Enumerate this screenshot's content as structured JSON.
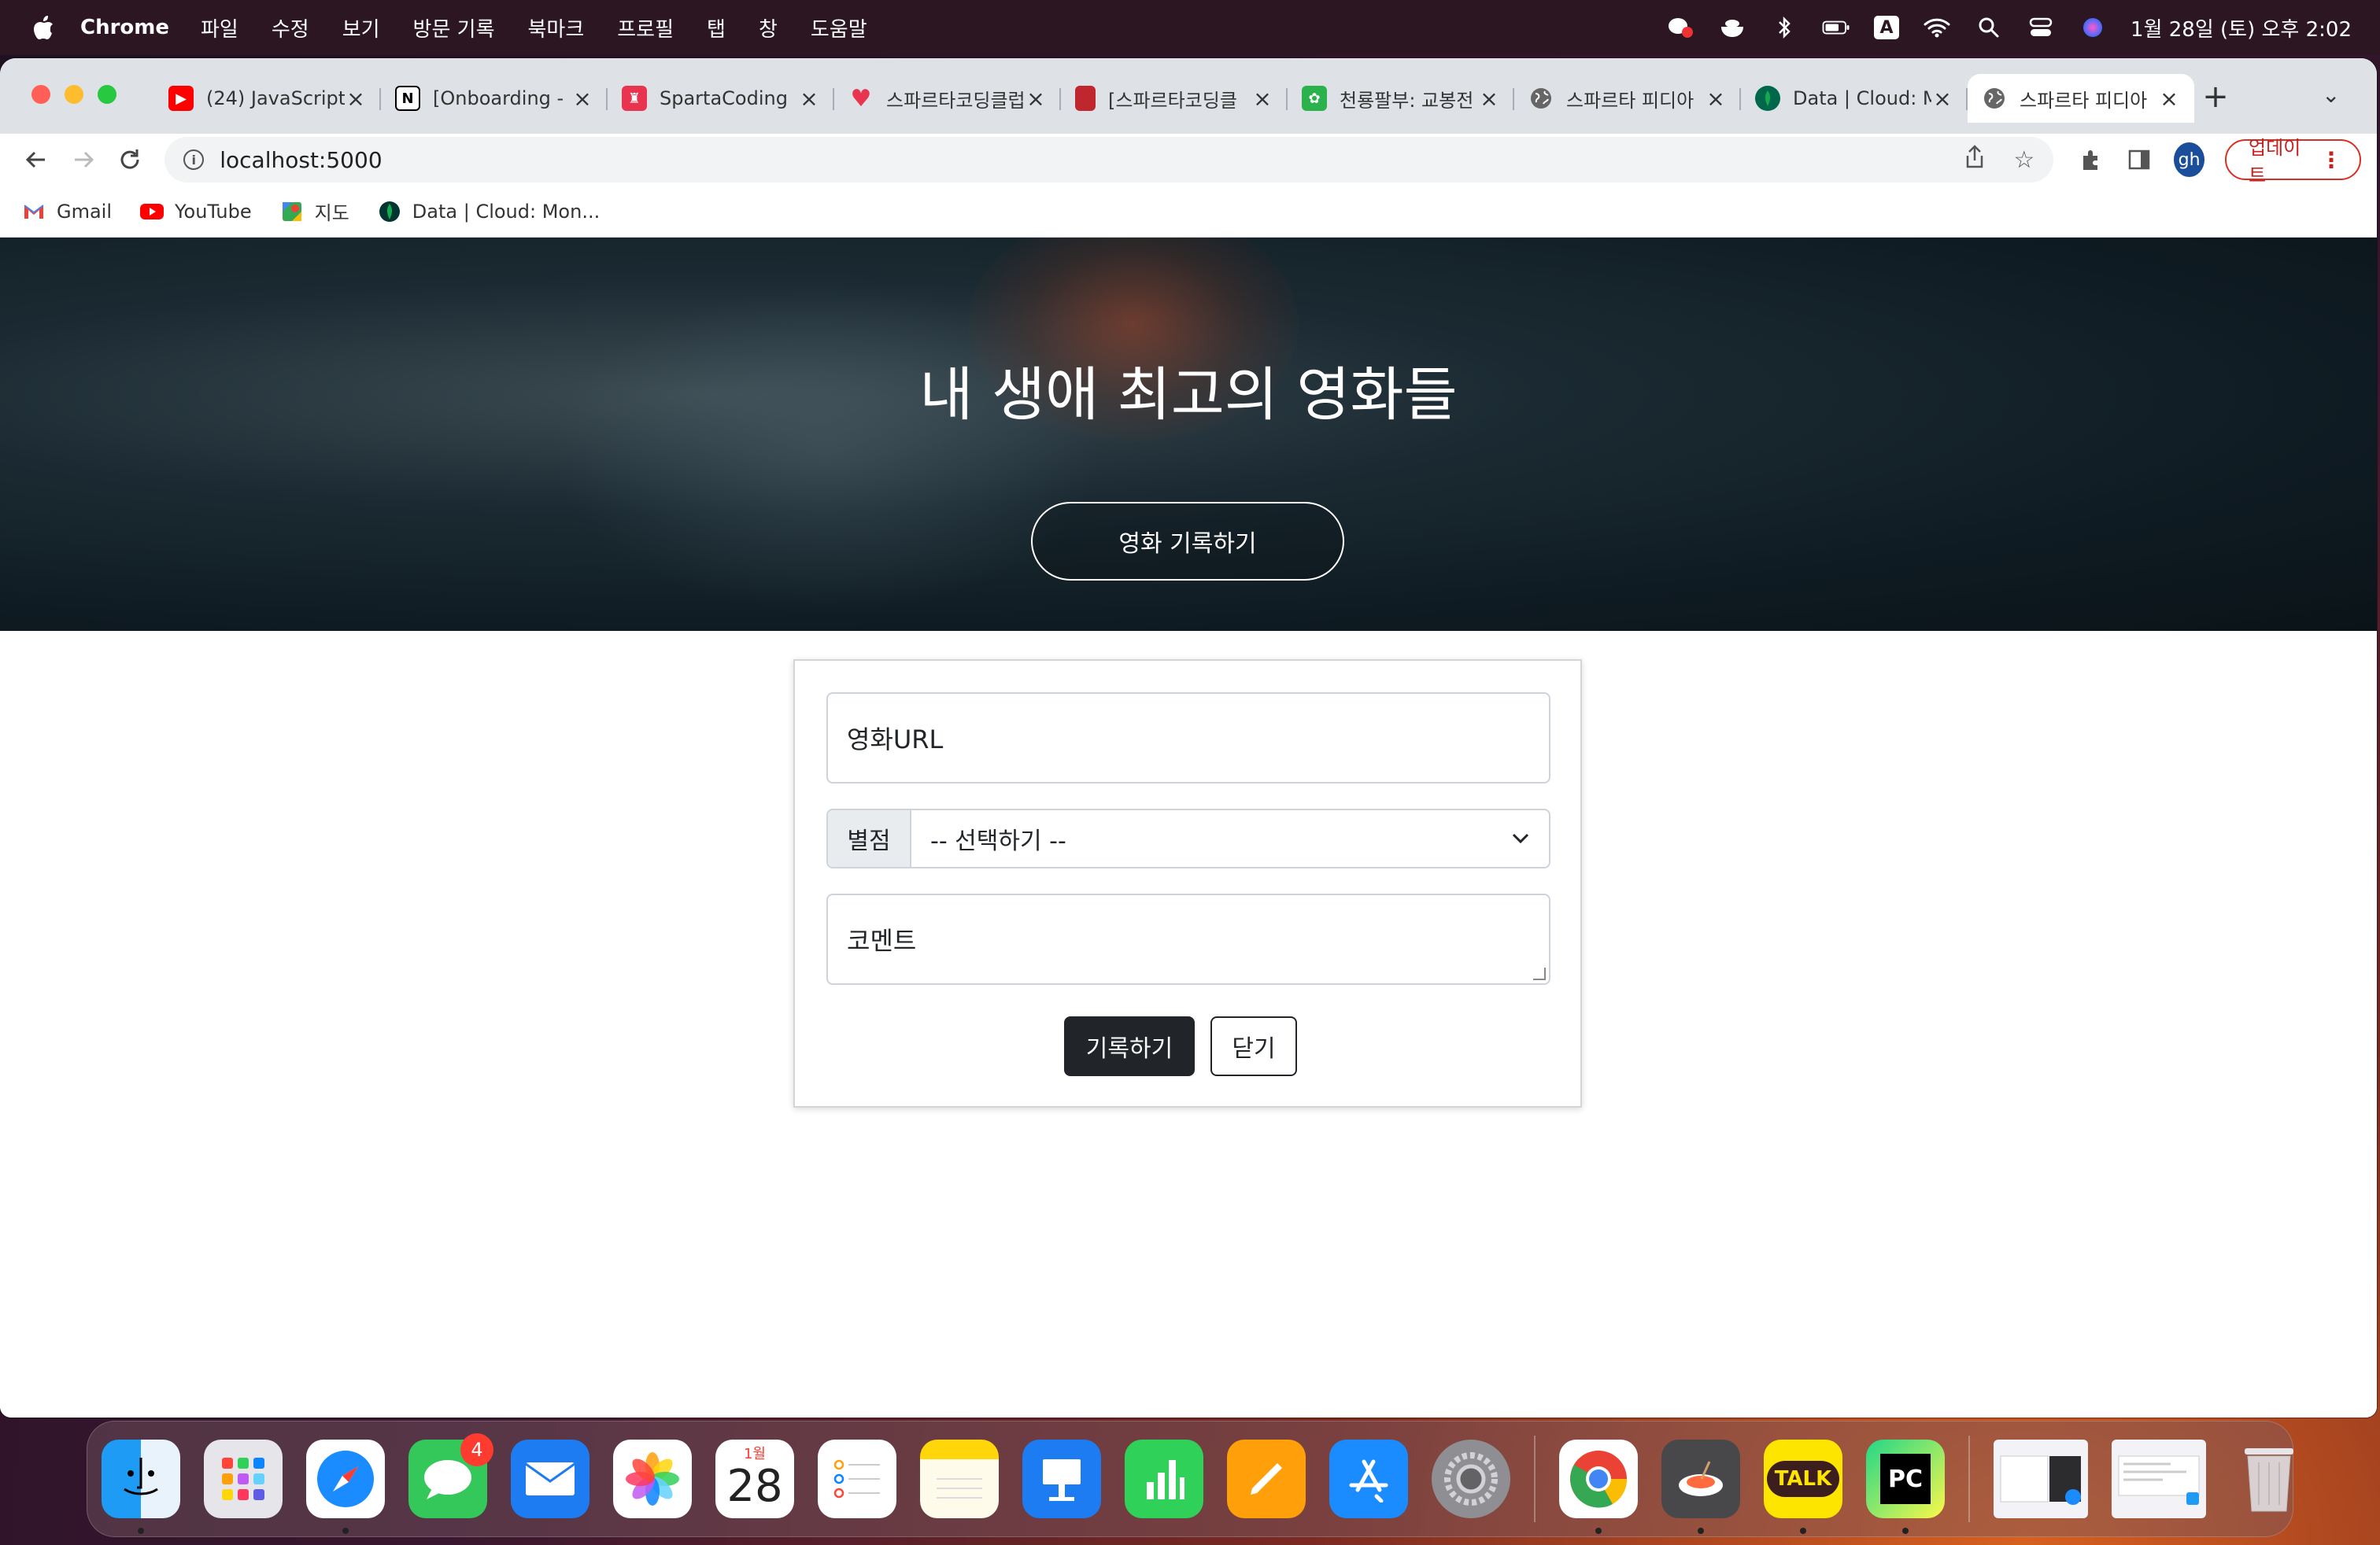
{
  "menubar": {
    "app_name": "Chrome",
    "menus": [
      "파일",
      "수정",
      "보기",
      "방문 기록",
      "북마크",
      "프로필",
      "탭",
      "창",
      "도움말"
    ],
    "clock": "1월 28일 (토) 오후 2:02",
    "input_indicator": "A"
  },
  "tabs": [
    {
      "title": "(24) JavaScript",
      "favicon": "youtube-icon",
      "color": "#ff0000"
    },
    {
      "title": "[Onboarding -",
      "favicon": "notion-icon",
      "color": "#000000"
    },
    {
      "title": "SpartaCoding",
      "favicon": "sparta-icon",
      "color": "#e8344e"
    },
    {
      "title": "스파르타코딩클럽",
      "favicon": "heart-icon",
      "color": "#e8344e"
    },
    {
      "title": "[스파르타코딩클",
      "favicon": "book-icon",
      "color": "#c0262d"
    },
    {
      "title": "천룡팔부: 교봉전",
      "favicon": "game-icon",
      "color": "#2bb24c"
    },
    {
      "title": "스파르타 피디아",
      "favicon": "globe-icon",
      "color": "#555555"
    },
    {
      "title": "Data | Cloud: M",
      "favicon": "mongodb-icon",
      "color": "#00684a"
    },
    {
      "title": "스파르타 피디아",
      "favicon": "globe-icon",
      "color": "#555555",
      "active": true
    }
  ],
  "toolbar": {
    "url": "localhost:5000",
    "profile_initials": "gh",
    "update_label": "업데이트"
  },
  "bookmarks": [
    {
      "label": "Gmail",
      "icon": "gmail-icon"
    },
    {
      "label": "YouTube",
      "icon": "youtube-icon"
    },
    {
      "label": "지도",
      "icon": "maps-icon"
    },
    {
      "label": "Data | Cloud: Mon...",
      "icon": "mongodb-icon"
    }
  ],
  "hero": {
    "title": "내 생애 최고의 영화들",
    "button_label": "영화 기록하기"
  },
  "form": {
    "url_placeholder": "영화URL",
    "rating_label": "별점",
    "rating_selected": "-- 선택하기 --",
    "comment_placeholder": "코멘트",
    "save_label": "기록하기",
    "close_label": "닫기"
  },
  "dock": {
    "messages_badge": "4",
    "calendar_month": "1월",
    "calendar_day": "28",
    "talk_label": "TALK",
    "pycharm_label": "PC"
  }
}
